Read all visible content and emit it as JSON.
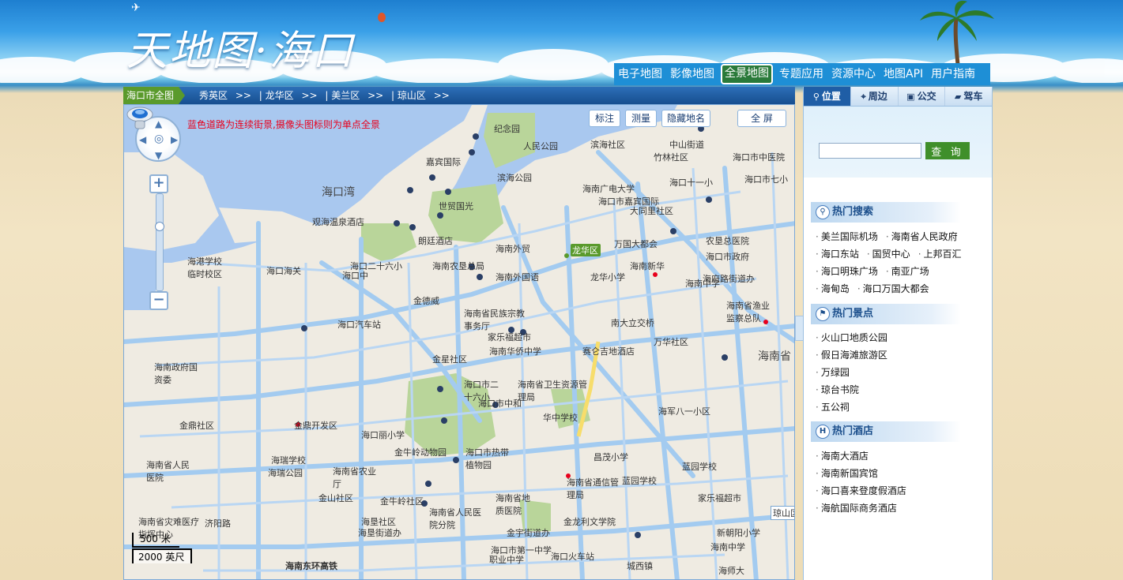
{
  "header": {
    "logo_text": "天地图·海口"
  },
  "nav": {
    "items": [
      {
        "label": "电子地图",
        "active": false
      },
      {
        "label": "影像地图",
        "active": false
      },
      {
        "label": "全景地图",
        "active": true
      },
      {
        "label": "专题应用",
        "active": false
      },
      {
        "label": "资源中心",
        "active": false
      },
      {
        "label": "地图API",
        "active": false
      },
      {
        "label": "用户指南",
        "active": false
      }
    ]
  },
  "breadcrumb": {
    "home": "海口市全图",
    "districts": [
      "秀英区",
      ">>",
      "| 龙华区",
      ">>",
      "| 美兰区",
      ">>",
      "| 琼山区",
      ">>"
    ]
  },
  "map": {
    "hint": "蓝色道路为连续街景,摄像头图标则为单点全景",
    "toolbar": {
      "mark": "标注",
      "measure": "测量",
      "hide_names": "隐藏地名",
      "fullscreen": "全 屏"
    },
    "scale": {
      "metric": "500 米",
      "imperial": "2000 英尺"
    },
    "labels": [
      "纪念园",
      "人民公园",
      "滨海社区",
      "中山街道",
      "竹林社区",
      "海口市中医院",
      "海口市七小",
      "海口十一小",
      "海南广电大学",
      "海口市嘉宾国际",
      "海口湾",
      "滨海公园",
      "世贸国光",
      "嘉宾国际",
      "观海温泉酒店",
      "朗廷酒店",
      "万国大都会",
      "大同里社区",
      "海南外贸",
      "龙华区",
      "海港学校临时校区",
      "海口二十六小",
      "海口海关",
      "海口中",
      "海南农垦总局",
      "海南外国语",
      "海南新华",
      "金德威",
      "海口汽车站",
      "龙华小学",
      "海南省民族宗教事务厅",
      "家乐福超市",
      "海南华侨中学",
      "赛仑吉地酒店",
      "南大立交桥",
      "万华社区",
      "海南省",
      "海口市二十六小",
      "海口市中和",
      "金星社区",
      "海南政府国资委",
      "海南省卫生资源管理局",
      "华中学校",
      "海军八一小区",
      "金鼎社区",
      "金鼎开发区",
      "海口丽小学",
      "海瑞学校",
      "海瑞公园",
      "金牛岭动物园",
      "海口市热带植物园",
      "海南省人民医院",
      "昌茂小学",
      "蓝园学校",
      "海南省农业厅",
      "海南省灾难医疗指挥中心",
      "济阳路",
      "金山社区",
      "金牛岭社区",
      "海垦社区",
      "海垦街道办",
      "海南省人民医院分院",
      "海口市第一中学",
      "金宇街道办",
      "海南省地质医院",
      "金龙利文学院",
      "海南省通信管理局",
      "家乐福超市",
      "新朝阳小学",
      "海南中学",
      "海口火车站",
      "职业中学",
      "城西镇",
      "海师大",
      "琼山区",
      "海南东环高铁",
      "海南省渔业监察总队",
      "海府路街道办",
      "海南中学",
      "蓝园学校",
      "农垦总医院",
      "海口市政府"
    ]
  },
  "panel": {
    "tabs": [
      {
        "label": "位置",
        "icon": "search-icon",
        "active": true
      },
      {
        "label": "周边",
        "icon": "nearby-icon",
        "active": false
      },
      {
        "label": "公交",
        "icon": "bus-icon",
        "active": false
      },
      {
        "label": "驾车",
        "icon": "car-icon",
        "active": false
      }
    ],
    "search": {
      "value": "",
      "button": "查 询"
    },
    "sections": [
      {
        "title": "热门搜索",
        "icon": "search-icon",
        "rows": [
          [
            "美兰国际机场",
            "海南省人民政府"
          ],
          [
            "海口东站",
            "国贸中心",
            "上邦百汇"
          ],
          [
            "海口明珠广场",
            "南亚广场"
          ],
          [
            "海甸岛",
            "海口万国大都会"
          ]
        ]
      },
      {
        "title": "热门景点",
        "icon": "flag-icon",
        "rows": [
          [
            "火山口地质公园"
          ],
          [
            "假日海滩旅游区"
          ],
          [
            "万绿园"
          ],
          [
            "琼台书院"
          ],
          [
            "五公祠"
          ]
        ]
      },
      {
        "title": "热门酒店",
        "icon": "hotel-icon",
        "rows": [
          [
            "海南大酒店"
          ],
          [
            "海南新国宾馆"
          ],
          [
            "海口喜来登度假酒店"
          ],
          [
            "海航国际商务酒店"
          ]
        ]
      }
    ]
  }
}
